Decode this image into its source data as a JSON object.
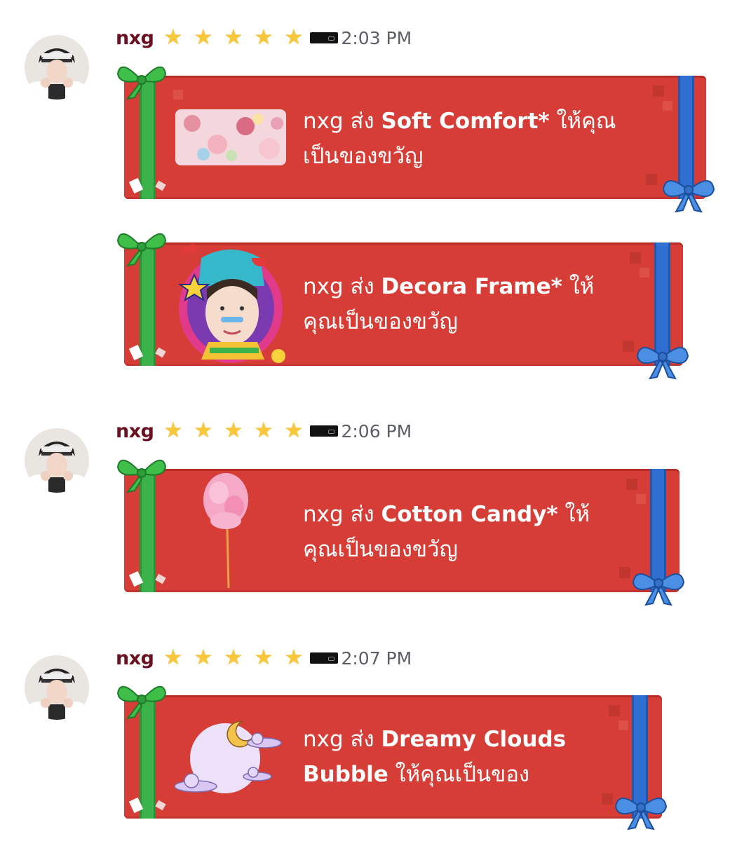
{
  "messages": [
    {
      "username": "nxg",
      "time": "2:03 PM",
      "gifts": [
        {
          "sender": "nxg",
          "verb": "ส่ง",
          "item": "Soft Comfort*",
          "suffix": "ให้คุณ",
          "line2": "เป็นของขวัญ",
          "thumb": "soft-comfort-thumbnail"
        },
        {
          "sender": "nxg",
          "verb": "ส่ง",
          "item": "Decora Frame*",
          "suffix": "ให้",
          "line2": "คุณเป็นของขวัญ",
          "thumb": "decora-frame-thumbnail"
        }
      ]
    },
    {
      "username": "nxg",
      "time": "2:06 PM",
      "gifts": [
        {
          "sender": "nxg",
          "verb": "ส่ง",
          "item": "Cotton Candy*",
          "suffix": "ให้",
          "line2": "คุณเป็นของขวัญ",
          "thumb": "cotton-candy-thumbnail"
        }
      ]
    },
    {
      "username": "nxg",
      "time": "2:07 PM",
      "gifts": [
        {
          "sender": "nxg",
          "verb": "ส่ง",
          "item": "Dreamy Clouds",
          "suffix": "",
          "line2_item": "Bubble",
          "line2": "ให้คุณเป็นของ",
          "thumb": "dreamy-clouds-thumbnail"
        }
      ]
    }
  ],
  "colors": {
    "gift_bg": "#d63d37",
    "ribbon_green": "#3bb34a",
    "ribbon_blue": "#2f6fd1",
    "username": "#6b1020",
    "timestamp": "#5c5e66",
    "star": "#f8c83a"
  },
  "icons": {
    "star": "star-icon",
    "badge": "guild-tag-icon"
  }
}
